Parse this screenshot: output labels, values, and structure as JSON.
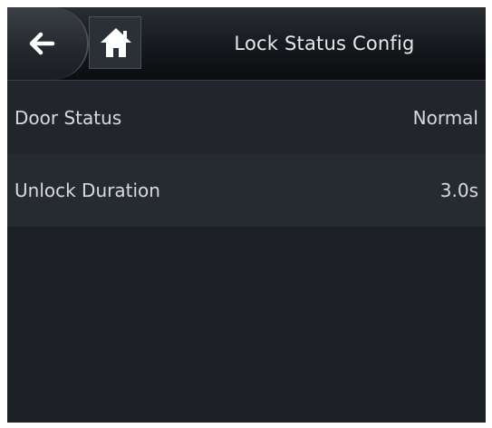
{
  "header": {
    "title": "Lock Status Config",
    "back_icon": "arrow-left-icon",
    "home_icon": "home-icon"
  },
  "settings": [
    {
      "label": "Door Status",
      "value": "Normal"
    },
    {
      "label": "Unlock Duration",
      "value": "3.0s"
    }
  ],
  "colors": {
    "screen_background": "#1d2127",
    "header_background": "#15181c",
    "row_background_1": "#22262c",
    "row_background_2": "#262b31",
    "text": "#d8dadc"
  }
}
